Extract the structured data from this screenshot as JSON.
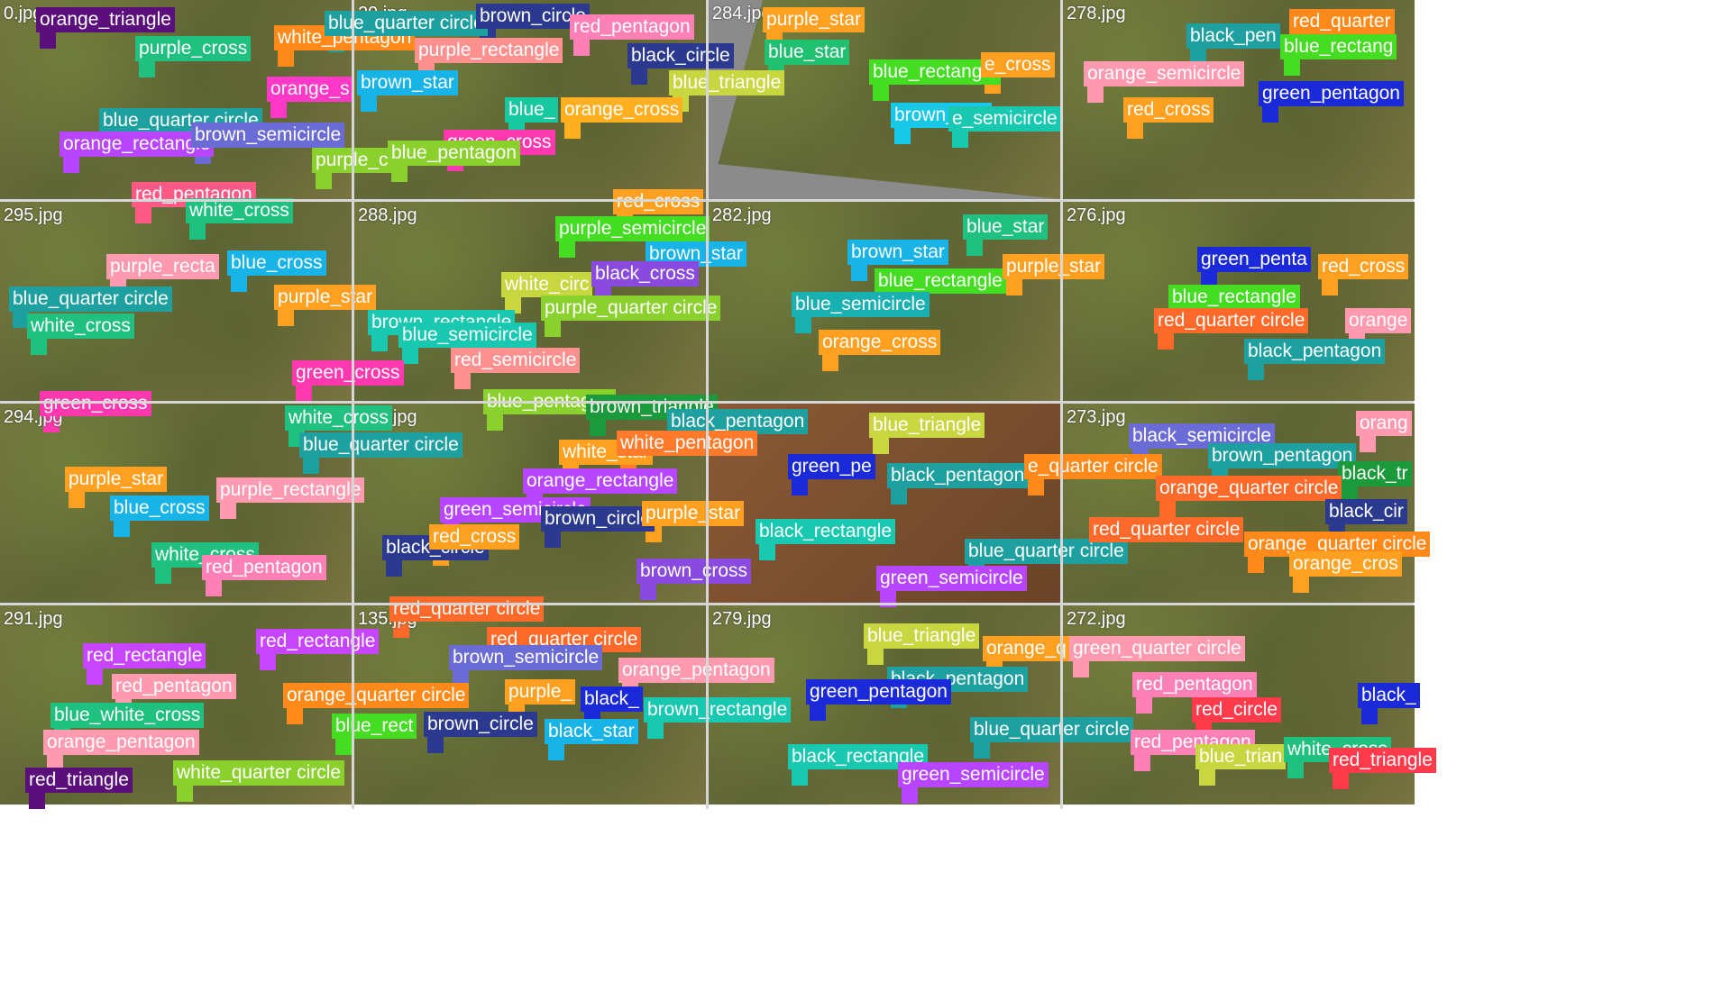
{
  "image": {
    "title": "",
    "tiles": [
      {
        "id": "t0",
        "name": "0.jpg",
        "labels": [
          {
            "t": "orange_triangle",
            "c": "#5a0f7a"
          },
          {
            "t": "purple_cross",
            "c": "#20c080"
          },
          {
            "t": "white_pentagon",
            "c": "#ff8a1a"
          },
          {
            "t": "orange_s",
            "c": "#ff38c8"
          },
          {
            "t": "blue_quarter circle",
            "c": "#1ea0a0"
          },
          {
            "t": "orange_rectangle",
            "c": "#b845ff"
          },
          {
            "t": "brown_semicircle",
            "c": "#6b6bd6"
          },
          {
            "t": "purple_c",
            "c": "#8bd12e"
          },
          {
            "t": "red_pentagon",
            "c": "#ff5a86"
          },
          {
            "t": "white_cross",
            "c": "#20c080"
          }
        ]
      },
      {
        "id": "t1",
        "name": "29.jpg",
        "labels": [
          {
            "t": "blue_quarter circle",
            "c": "#1ea0a0"
          },
          {
            "t": "brown_circle",
            "c": "#2b3a8f"
          },
          {
            "t": "red_pentagon",
            "c": "#ff80b6"
          },
          {
            "t": "purple_rectangle",
            "c": "#ff9090"
          },
          {
            "t": "brown_star",
            "c": "#18b4e8"
          },
          {
            "t": "black_circle",
            "c": "#2b3a8f"
          },
          {
            "t": "blue_triangle",
            "c": "#c8d640"
          },
          {
            "t": "blue_",
            "c": "#18c8a0"
          },
          {
            "t": "orange_cross",
            "c": "#ffb020"
          },
          {
            "t": "green_cross",
            "c": "#ff38b0"
          },
          {
            "t": "blue_pentagon",
            "c": "#8bd12e"
          }
        ]
      },
      {
        "id": "t2",
        "name": "284.jpg",
        "labels": [
          {
            "t": "purple_star",
            "c": "#ffa020"
          },
          {
            "t": "blue_star",
            "c": "#20c070"
          },
          {
            "t": "blue_rectangle",
            "c": "#44dd22"
          },
          {
            "t": "e_cross",
            "c": "#ffa020"
          },
          {
            "t": "brown_star",
            "c": "#18c8e8"
          },
          {
            "t": "e_semicircle",
            "c": "#18c8b0"
          }
        ]
      },
      {
        "id": "t3",
        "name": "278.jpg",
        "labels": [
          {
            "t": "black_pen",
            "c": "#1ea0a0"
          },
          {
            "t": "red_quarter",
            "c": "#ff8a1a"
          },
          {
            "t": "blue_rectang",
            "c": "#44dd22"
          },
          {
            "t": "orange_semicircle",
            "c": "#ff9ab0"
          },
          {
            "t": "green_pentagon",
            "c": "#1a2ad8"
          },
          {
            "t": "red_cross",
            "c": "#ffa020"
          }
        ]
      },
      {
        "id": "t4",
        "name": "295.jpg",
        "labels": [
          {
            "t": "purple_recta",
            "c": "#ff9ab0"
          },
          {
            "t": "blue_cross",
            "c": "#18b4e8"
          },
          {
            "t": "blue_quarter circle",
            "c": "#1ea0a0"
          },
          {
            "t": "white_cross",
            "c": "#20c080"
          },
          {
            "t": "purple_star",
            "c": "#ffa020"
          },
          {
            "t": "green_cross",
            "c": "#ff38b0"
          }
        ]
      },
      {
        "id": "t5",
        "name": "288.jpg",
        "labels": [
          {
            "t": "red_cross",
            "c": "#ffa020"
          },
          {
            "t": "purple_semicircle",
            "c": "#44dd22"
          },
          {
            "t": "brown_star",
            "c": "#18b4e8"
          },
          {
            "t": "white_circ",
            "c": "#c8d640"
          },
          {
            "t": "black_cross",
            "c": "#8a4ae0"
          },
          {
            "t": "purple_quarter circle",
            "c": "#8bd12e"
          },
          {
            "t": "brown_rectangle",
            "c": "#18c8b0"
          },
          {
            "t": "blue_semicircle",
            "c": "#18c8b0"
          },
          {
            "t": "red_semicircle",
            "c": "#ff9090"
          },
          {
            "t": "blue_pentagon",
            "c": "#8bd12e"
          },
          {
            "t": "green_cross",
            "c": "#ff38b0"
          }
        ]
      },
      {
        "id": "t6",
        "name": "282.jpg",
        "labels": [
          {
            "t": "blue_star",
            "c": "#20c080"
          },
          {
            "t": "brown_star",
            "c": "#18b4e8"
          },
          {
            "t": "blue_rectangle",
            "c": "#44dd22"
          },
          {
            "t": "purple_star",
            "c": "#ffa020"
          },
          {
            "t": "blue_semicircle",
            "c": "#18b0b0"
          },
          {
            "t": "orange_cross",
            "c": "#ffa020"
          }
        ]
      },
      {
        "id": "t7",
        "name": "276.jpg",
        "labels": [
          {
            "t": "green_penta",
            "c": "#1a2ad8"
          },
          {
            "t": "red_cross",
            "c": "#ffa020"
          },
          {
            "t": "blue_rectangle",
            "c": "#44dd22"
          },
          {
            "t": "red_quarter circle",
            "c": "#ff6a2a"
          },
          {
            "t": "orange",
            "c": "#ff9ab0"
          },
          {
            "t": "black_pentagon",
            "c": "#1ea0a0"
          }
        ]
      },
      {
        "id": "t8",
        "name": "294.jpg",
        "labels": [
          {
            "t": "white_cross",
            "c": "#20c080"
          },
          {
            "t": "blue_quarter circle",
            "c": "#1ea0a0"
          },
          {
            "t": "purple_star",
            "c": "#ffa020"
          },
          {
            "t": "blue_cross",
            "c": "#18b4e8"
          },
          {
            "t": "purple_rectangle",
            "c": "#ff9ab0"
          },
          {
            "t": "white_cross",
            "c": "#20c080"
          },
          {
            "t": "red_pentagon",
            "c": "#ff80b6"
          }
        ]
      },
      {
        "id": "t9",
        "name": "285.jpg",
        "labels": [
          {
            "t": "brown_triangle",
            "c": "#1a9a3a"
          },
          {
            "t": "black_pentagon",
            "c": "#1ea0a0"
          },
          {
            "t": "white_star",
            "c": "#ffa020"
          },
          {
            "t": "white_pentagon",
            "c": "#ff7a2a"
          },
          {
            "t": "orange_rectangle",
            "c": "#b845ff"
          },
          {
            "t": "green_semicircle",
            "c": "#b845ff"
          },
          {
            "t": "brown_circle",
            "c": "#2b3a8f"
          },
          {
            "t": "purple_star",
            "c": "#ffa020"
          },
          {
            "t": "black_circle",
            "c": "#2b3a8f"
          },
          {
            "t": "red_cross",
            "c": "#ffa020"
          },
          {
            "t": "brown_cross",
            "c": "#8a4ae0"
          }
        ]
      },
      {
        "id": "t10",
        "name": "",
        "labels": [
          {
            "t": "blue_triangle",
            "c": "#c8d640"
          },
          {
            "t": "green_pe",
            "c": "#1a2ad8"
          },
          {
            "t": "black_pentagon",
            "c": "#1ea0a0"
          },
          {
            "t": "black_rectangle",
            "c": "#18c8b0"
          },
          {
            "t": "blue_quarter circle",
            "c": "#1ea0a0"
          },
          {
            "t": "green_semicircle",
            "c": "#b845ff"
          }
        ]
      },
      {
        "id": "t11",
        "name": "273.jpg",
        "labels": [
          {
            "t": "black_semicircle",
            "c": "#6b6bd6"
          },
          {
            "t": "orang",
            "c": "#ff9ab0"
          },
          {
            "t": "brown_pentagon",
            "c": "#1ea0a0"
          },
          {
            "t": "e_quarter circle",
            "c": "#ff8a1a"
          },
          {
            "t": "black_tr",
            "c": "#1a9a3a"
          },
          {
            "t": "orange_quarter circle",
            "c": "#ff6a2a"
          },
          {
            "t": "black_cir",
            "c": "#2b3a8f"
          },
          {
            "t": "red_quarter circle",
            "c": "#ff6a2a"
          },
          {
            "t": "orange_quarter circle",
            "c": "#ff8a1a"
          },
          {
            "t": "orange_cros",
            "c": "#ffa020"
          }
        ]
      },
      {
        "id": "t12",
        "name": "291.jpg",
        "labels": [
          {
            "t": "red_rectangle",
            "c": "#c845ff"
          },
          {
            "t": "red_pentagon",
            "c": "#ff9ab0"
          },
          {
            "t": "blue_white_cross",
            "c": "#20c080"
          },
          {
            "t": "orange_pentagon",
            "c": "#ff9ab0"
          },
          {
            "t": "red_triangle",
            "c": "#5a0f7a"
          },
          {
            "t": "white_quarter circle",
            "c": "#8bd12e"
          }
        ]
      },
      {
        "id": "t13",
        "name": "135.jpg",
        "labels": [
          {
            "t": "red_quarter circle",
            "c": "#ff6a2a"
          },
          {
            "t": "red_rectangle",
            "c": "#c845ff"
          },
          {
            "t": "red_quarter circle",
            "c": "#ff6a2a"
          },
          {
            "t": "brown_semicircle",
            "c": "#6b6bd6"
          },
          {
            "t": "orange_pentagon",
            "c": "#ff9ab0"
          },
          {
            "t": "orange_quarter circle",
            "c": "#ff8a1a"
          },
          {
            "t": "purple_",
            "c": "#ffa020"
          },
          {
            "t": "black_",
            "c": "#1a2ad8"
          },
          {
            "t": "blue_rect",
            "c": "#44dd22"
          },
          {
            "t": "brown_circle",
            "c": "#2b3a8f"
          },
          {
            "t": "black_star",
            "c": "#18b4e8"
          },
          {
            "t": "brown_rectangle",
            "c": "#18c8b0"
          }
        ]
      },
      {
        "id": "t14",
        "name": "279.jpg",
        "labels": [
          {
            "t": "blue_triangle",
            "c": "#c8d640"
          },
          {
            "t": "orange_q",
            "c": "#ffa020"
          },
          {
            "t": "black_pentagon",
            "c": "#1ea0a0"
          },
          {
            "t": "green_pentagon",
            "c": "#1a2ad8"
          },
          {
            "t": "blue_quarter circle",
            "c": "#1ea0a0"
          },
          {
            "t": "black_rectangle",
            "c": "#18c8b0"
          },
          {
            "t": "green_semicircle",
            "c": "#b845ff"
          }
        ]
      },
      {
        "id": "t15",
        "name": "272.jpg",
        "labels": [
          {
            "t": "green_quarter circle",
            "c": "#ff9ab0"
          },
          {
            "t": "red_pentagon",
            "c": "#ff80b6"
          },
          {
            "t": "red_circle",
            "c": "#ff3a4a"
          },
          {
            "t": "black_",
            "c": "#1a2ad8"
          },
          {
            "t": "red_pentagon",
            "c": "#ff80b6"
          },
          {
            "t": "blue_trian",
            "c": "#c8d640"
          },
          {
            "t": "white_cross",
            "c": "#20c080"
          },
          {
            "t": "red_triangle",
            "c": "#ff3a4a"
          }
        ]
      }
    ]
  }
}
